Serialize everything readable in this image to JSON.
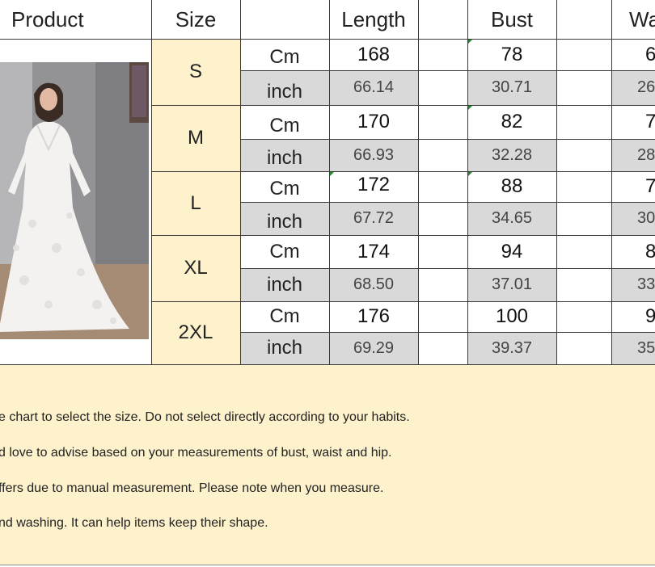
{
  "header": {
    "product": "Product",
    "size": "Size",
    "length": "Length",
    "bust": "Bust",
    "waist": "Wa"
  },
  "units": {
    "cm": "Cm",
    "inch": "inch"
  },
  "rows": [
    {
      "size": "S",
      "cm": {
        "length": "168",
        "bust": "78",
        "waist": "6"
      },
      "inch": {
        "length": "66.14",
        "bust": "30.71",
        "waist": "26"
      }
    },
    {
      "size": "M",
      "cm": {
        "length": "170",
        "bust": "82",
        "waist": "7"
      },
      "inch": {
        "length": "66.93",
        "bust": "32.28",
        "waist": "28"
      }
    },
    {
      "size": "L",
      "cm": {
        "length": "172",
        "bust": "88",
        "waist": "7"
      },
      "inch": {
        "length": "67.72",
        "bust": "34.65",
        "waist": "30"
      }
    },
    {
      "size": "XL",
      "cm": {
        "length": "174",
        "bust": "94",
        "waist": "8"
      },
      "inch": {
        "length": "68.50",
        "bust": "37.01",
        "waist": "33"
      }
    },
    {
      "size": "2XL",
      "cm": {
        "length": "176",
        "bust": "100",
        "waist": "9"
      },
      "inch": {
        "length": "69.29",
        "bust": "39.37",
        "waist": "35"
      }
    }
  ],
  "notes": [
    "e chart to select the size. Do not select directly according to your habits.",
    "d love to advise based on your measurements of bust, waist and hip.",
    "ffers due to manual measurement. Please note when you measure.",
    "nd washing. It can help items keep their shape."
  ],
  "colors": {
    "size_bg": "#fef2cc",
    "inch_row_bg": "#d9d9d9",
    "notes_bg": "#fef2cc"
  },
  "image": {
    "name": "product-photo",
    "subject": "white lace long-sleeve maxi dress"
  }
}
